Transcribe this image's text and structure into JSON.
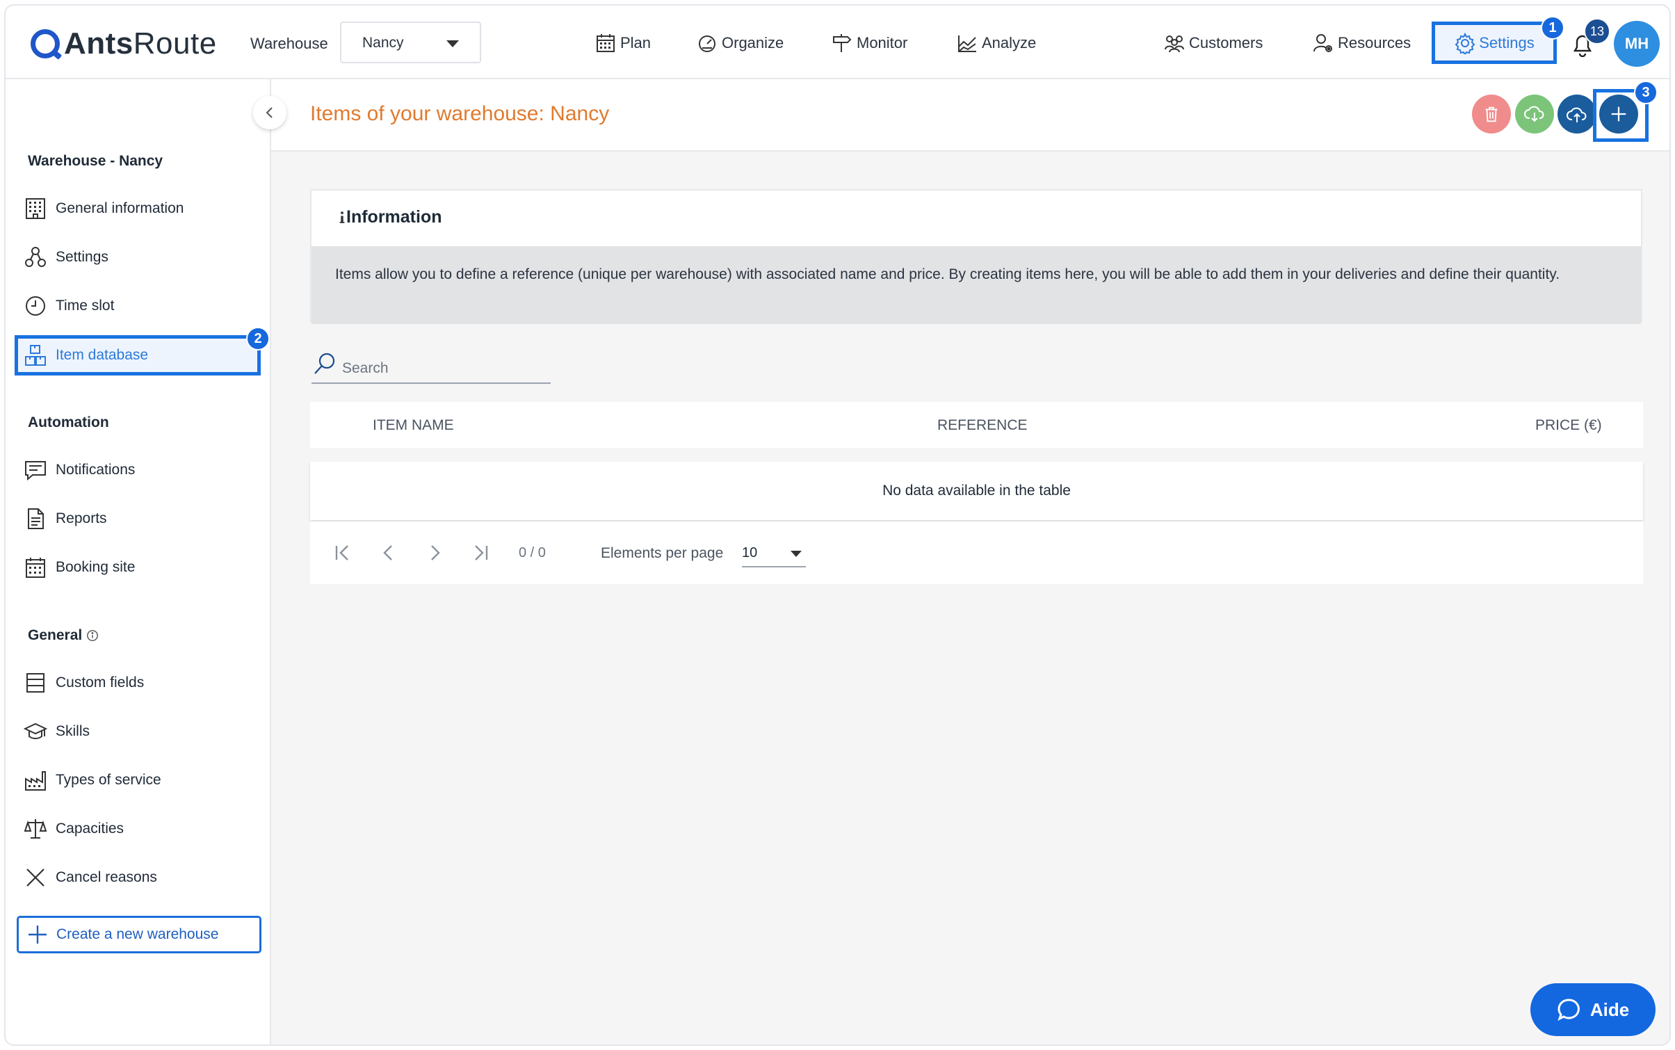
{
  "app": {
    "brand_bold": "Ants",
    "brand_rest": "Route"
  },
  "header": {
    "warehouse_label": "Warehouse",
    "warehouse_value": "Nancy",
    "nav": [
      {
        "label": "Plan",
        "icon": "calendar-icon"
      },
      {
        "label": "Organize",
        "icon": "speedometer-icon"
      },
      {
        "label": "Monitor",
        "icon": "signpost-icon"
      },
      {
        "label": "Analyze",
        "icon": "chart-icon"
      },
      {
        "label": "Customers",
        "icon": "people-icon"
      },
      {
        "label": "Resources",
        "icon": "user-gear-icon"
      },
      {
        "label": "Settings",
        "icon": "gear-icon"
      }
    ],
    "notification_count": "13",
    "avatar_initials": "MH"
  },
  "steps": {
    "one": "1",
    "two": "2",
    "three": "3"
  },
  "sidebar": {
    "section_warehouse": "Warehouse - Nancy",
    "warehouse_items": [
      {
        "label": "General information",
        "icon": "building-icon"
      },
      {
        "label": "Settings",
        "icon": "molecule-icon"
      },
      {
        "label": "Time slot",
        "icon": "clock-icon"
      },
      {
        "label": "Item database",
        "icon": "boxes-icon",
        "active": true
      }
    ],
    "section_automation": "Automation",
    "automation_items": [
      {
        "label": "Notifications",
        "icon": "message-icon"
      },
      {
        "label": "Reports",
        "icon": "document-icon"
      },
      {
        "label": "Booking site",
        "icon": "calendar-grid-icon"
      }
    ],
    "section_general": "General",
    "general_items": [
      {
        "label": "Custom fields",
        "icon": "list-icon"
      },
      {
        "label": "Skills",
        "icon": "graduation-cap-icon"
      },
      {
        "label": "Types of service",
        "icon": "factory-icon"
      },
      {
        "label": "Capacities",
        "icon": "scale-icon"
      },
      {
        "label": "Cancel reasons",
        "icon": "x-icon"
      }
    ],
    "create_label": "Create a new warehouse"
  },
  "page": {
    "title": "Items of your warehouse: Nancy",
    "info_title": "Information",
    "info_text": "Items allow you to define a reference (unique per warehouse) with associated name and price. By creating items here, you will be able to add them in your deliveries and define their quantity.",
    "search_placeholder": "Search",
    "columns": [
      "ITEM NAME",
      "REFERENCE",
      "PRICE (€)"
    ],
    "empty_text": "No data available in the table",
    "pager_count": "0 / 0",
    "per_page_label": "Elements per page",
    "per_page_value": "10"
  },
  "colors": {
    "accent": "#1872e0",
    "title_orange": "#e07a2e",
    "delete_red": "#f08c8c",
    "upload_green": "#7cc47a",
    "cloud_blue": "#1a5c9c",
    "add_blue": "#1a5c9c"
  },
  "help": {
    "label": "Aide"
  }
}
